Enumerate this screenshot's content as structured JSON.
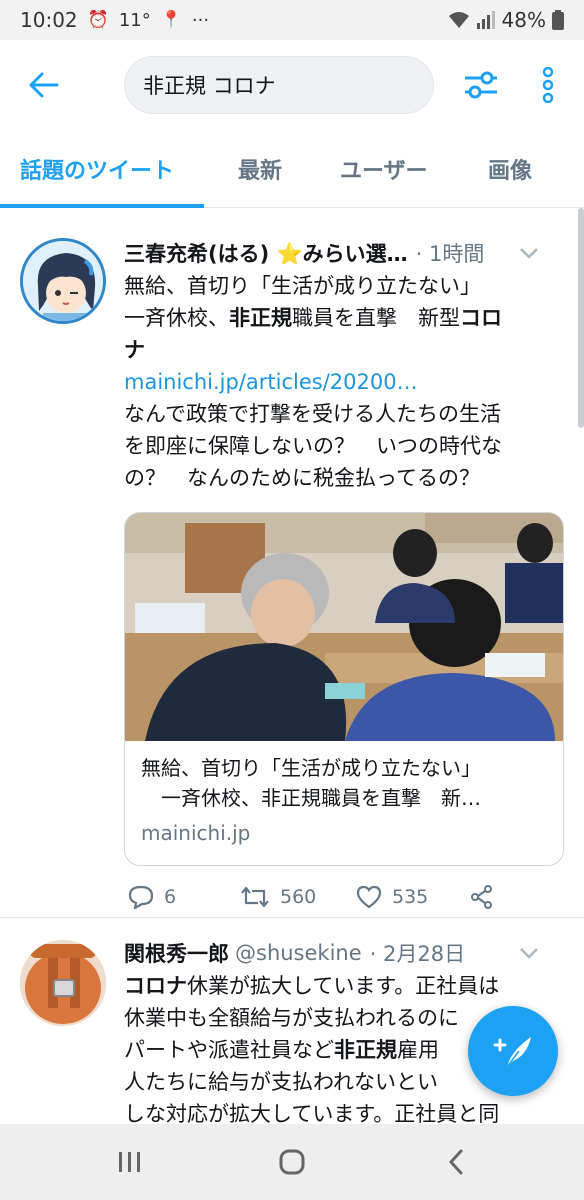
{
  "status_bar": {
    "time": "10:02",
    "temperature": "11°",
    "dots": "···",
    "battery": "48%"
  },
  "search": {
    "query": "非正規 コロナ"
  },
  "tabs": [
    {
      "label": "話題のツイート",
      "active": true
    },
    {
      "label": "最新",
      "active": false
    },
    {
      "label": "ユーザー",
      "active": false
    },
    {
      "label": "画像",
      "active": false
    }
  ],
  "tweets": [
    {
      "name": "三春充希(はる) ⭐みらい選…",
      "handle": "",
      "time": "· 1時間",
      "text_lines": [
        "無給、首切り「生活が成り立たない」",
        "一斉休校、<b>非正規</b>職員を直撃　新型<b>コロ</b>",
        "<b>ナ</b>"
      ],
      "link": "mainichi.jp/articles/20200…",
      "body_lines": [
        "なんで政策で打撃を受ける人たちの生活",
        "を即座に保障しないの？　いつの時代な",
        "の？　なんのために税金払ってるの？"
      ],
      "card": {
        "title_line1": "無給、首切り「生活が成り立たない」",
        "title_line2": "　一斉休校、非正規職員を直撃　新…",
        "domain": "mainichi.jp"
      },
      "replies": "6",
      "retweets": "560",
      "likes": "535"
    },
    {
      "name": "関根秀一郎",
      "handle": "@shusekine",
      "time": "· 2月28日",
      "text_lines": [
        "<b>コロナ</b>休業が拡大しています。正社員は",
        "休業中も全額給与が支払われるのに",
        "パートや派遣社員など<b>非正規</b>雇用",
        "人たちに給与が支払われないとい",
        "しな対応が拡大しています。正社員と同"
      ]
    }
  ],
  "colors": {
    "accent": "#1da1f2",
    "text": "#14171a",
    "secondary": "#657786"
  }
}
